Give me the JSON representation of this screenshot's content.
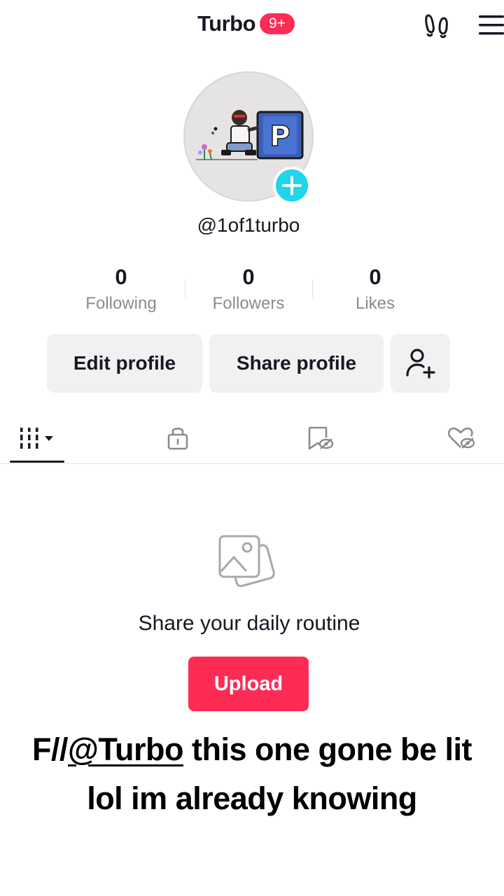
{
  "header": {
    "title": "Turbo",
    "badge": "9+",
    "footprint_icon": "footprint-icon",
    "menu_icon": "hamburger-menu-icon"
  },
  "profile": {
    "username": "@1of1turbo",
    "add_icon": "plus-icon"
  },
  "stats": [
    {
      "value": "0",
      "label": "Following"
    },
    {
      "value": "0",
      "label": "Followers"
    },
    {
      "value": "0",
      "label": "Likes"
    }
  ],
  "actions": {
    "edit": "Edit profile",
    "share": "Share profile",
    "add_friend_icon": "add-friend-icon"
  },
  "tabs": [
    {
      "icon": "grid-icon",
      "selected": true
    },
    {
      "icon": "lock-icon",
      "selected": false
    },
    {
      "icon": "hidden-bookmark-icon",
      "selected": false
    },
    {
      "icon": "hidden-heart-icon",
      "selected": false
    }
  ],
  "empty_state": {
    "icon": "photos-icon",
    "text": "Share your daily routine",
    "button": "Upload"
  },
  "caption": {
    "prefix": "F//",
    "mention": "@Turbo",
    "line1_rest": " this one gone be lit",
    "line2": "lol im already knowing"
  },
  "colors": {
    "accent": "#fe2c55",
    "add_button": "#20d5ec",
    "text": "#161823",
    "muted": "#8a8b91"
  }
}
